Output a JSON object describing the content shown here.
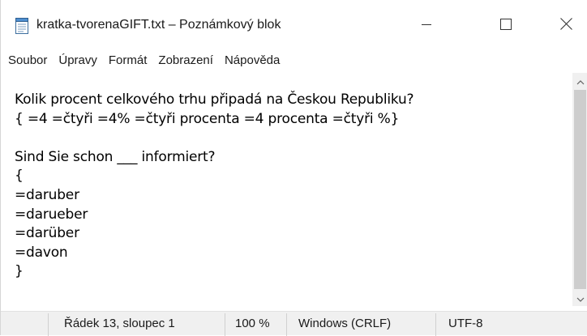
{
  "window": {
    "title": "kratka-tvorenaGIFT.txt – Poznámkový blok",
    "app_icon": "notepad-icon",
    "controls": [
      "minimize-icon",
      "maximize-icon",
      "close-icon"
    ]
  },
  "menu": {
    "items": [
      "Soubor",
      "Úpravy",
      "Formát",
      "Zobrazení",
      "Nápověda"
    ]
  },
  "editor": {
    "content": "Kolik procent celkového trhu připadá na Českou Republiku?\n{ =4 =čtyři =4% =čtyři procenta =4 procenta =čtyři %}\n\nSind Sie schon ___ informiert?\n{\n=daruber\n=darueber\n=darüber\n=davon\n}"
  },
  "status": {
    "position": "Řádek 13, sloupec 1",
    "zoom": "100 %",
    "line_endings": "Windows (CRLF)",
    "encoding": "UTF-8"
  },
  "colors": {
    "background": "#ffffff",
    "statusbar": "#f0f0f0",
    "scrollbar_track": "#f0f0f0",
    "scrollbar_thumb": "#cdcdcd"
  }
}
